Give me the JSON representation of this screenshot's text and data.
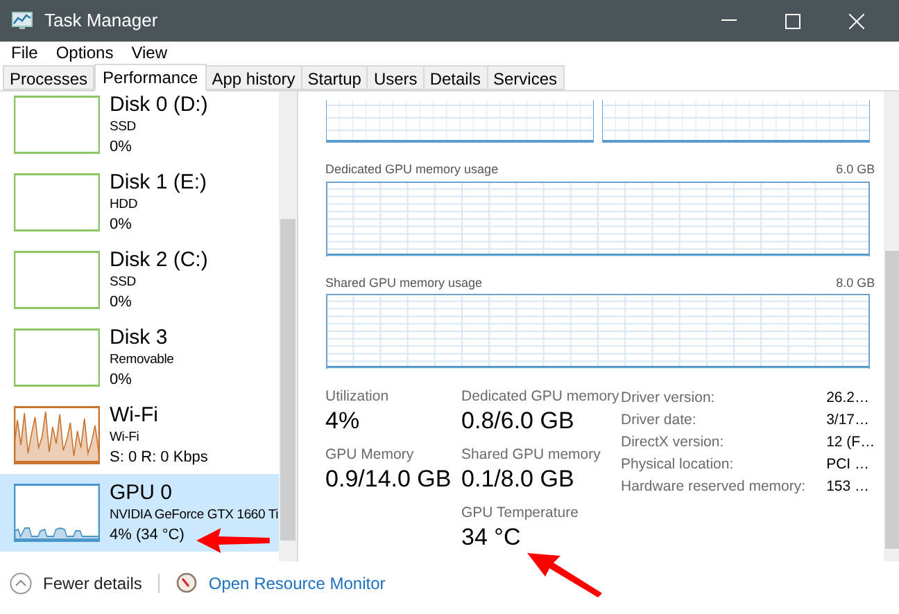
{
  "window": {
    "title": "Task Manager"
  },
  "menu": [
    "File",
    "Options",
    "View"
  ],
  "tabs": [
    {
      "label": "Processes",
      "selected": false
    },
    {
      "label": "Performance",
      "selected": true
    },
    {
      "label": "App history",
      "selected": false
    },
    {
      "label": "Startup",
      "selected": false
    },
    {
      "label": "Users",
      "selected": false
    },
    {
      "label": "Details",
      "selected": false
    },
    {
      "label": "Services",
      "selected": false
    }
  ],
  "sidebar": {
    "items": [
      {
        "name": "Disk 0 (D:)",
        "line_2": "SSD",
        "line_3": "0%",
        "color": "#8cc665",
        "selected": false,
        "kind": "flat"
      },
      {
        "name": "Disk 1 (E:)",
        "line_2": "HDD",
        "line_3": "0%",
        "color": "#8cc665",
        "selected": false,
        "kind": "flat"
      },
      {
        "name": "Disk 2 (C:)",
        "line_2": "SSD",
        "line_3": "0%",
        "color": "#8cc665",
        "selected": false,
        "kind": "flat"
      },
      {
        "name": "Disk 3",
        "line_2": "Removable",
        "line_3": "0%",
        "color": "#8cc665",
        "selected": false,
        "kind": "flat"
      },
      {
        "name": "Wi-Fi",
        "line_2": "Wi-Fi",
        "line_3": "S: 0 R: 0 Kbps",
        "color": "#c8732e",
        "selected": false,
        "kind": "busy"
      },
      {
        "name": "GPU 0",
        "line_2": "NVIDIA GeForce GTX 1660 Ti",
        "line_3": "4% (34 °C)",
        "color": "#4a95c9",
        "selected": true,
        "kind": "low"
      }
    ]
  },
  "graphs": [
    {
      "label": "Dedicated GPU memory usage",
      "max": "6.0 GB"
    },
    {
      "label": "Shared GPU memory usage",
      "max": "8.0 GB"
    }
  ],
  "stats": [
    [
      {
        "label": "Utilization",
        "value": "4%"
      },
      {
        "label": "GPU Memory",
        "value": "0.9/14.0 GB"
      }
    ],
    [
      {
        "label": "Dedicated GPU memory",
        "value": "0.8/6.0 GB"
      },
      {
        "label": "Shared GPU memory",
        "value": "0.1/8.0 GB"
      },
      {
        "label": "GPU Temperature",
        "value": "34 °C"
      }
    ]
  ],
  "details": [
    {
      "label": "Driver version:",
      "value": "26.2…"
    },
    {
      "label": "Driver date:",
      "value": "3/17…"
    },
    {
      "label": "DirectX version:",
      "value": "12 (F…"
    },
    {
      "label": "Physical location:",
      "value": "PCI …"
    },
    {
      "label": "Hardware reserved memory:",
      "value": "153 …"
    }
  ],
  "footer": {
    "fewer_details": "Fewer details",
    "resource_monitor": "Open Resource Monitor"
  }
}
